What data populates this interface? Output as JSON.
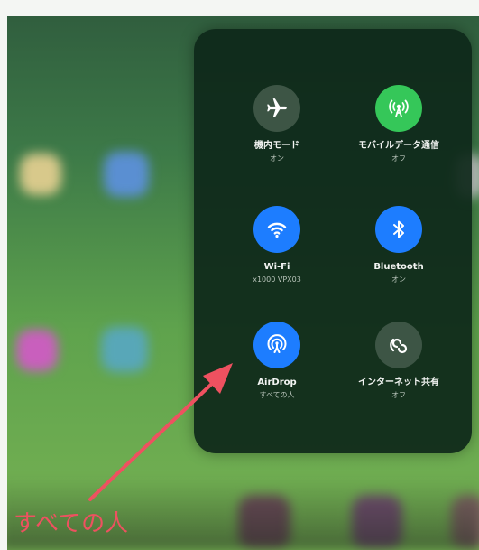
{
  "control_center": {
    "airplane": {
      "label": "機内モード",
      "status": "オン",
      "icon": "airplane-icon"
    },
    "cellular": {
      "label": "モバイルデータ通信",
      "status": "オフ",
      "icon": "antenna-icon"
    },
    "wifi": {
      "label": "Wi-Fi",
      "status": "x1000 VPX03",
      "icon": "wifi-icon"
    },
    "bluetooth": {
      "label": "Bluetooth",
      "status": "オン",
      "icon": "bluetooth-icon"
    },
    "airdrop": {
      "label": "AirDrop",
      "status": "すべての人",
      "icon": "airdrop-icon"
    },
    "hotspot": {
      "label": "インターネット共有",
      "status": "オフ",
      "icon": "hotspot-icon"
    }
  },
  "annotation": {
    "text": "すべての人",
    "color": "#ee5160"
  },
  "colors": {
    "active_blue": "#1d7dff",
    "active_green": "#35c759",
    "inactive": "#3d5545",
    "panel": "#0e281a"
  }
}
